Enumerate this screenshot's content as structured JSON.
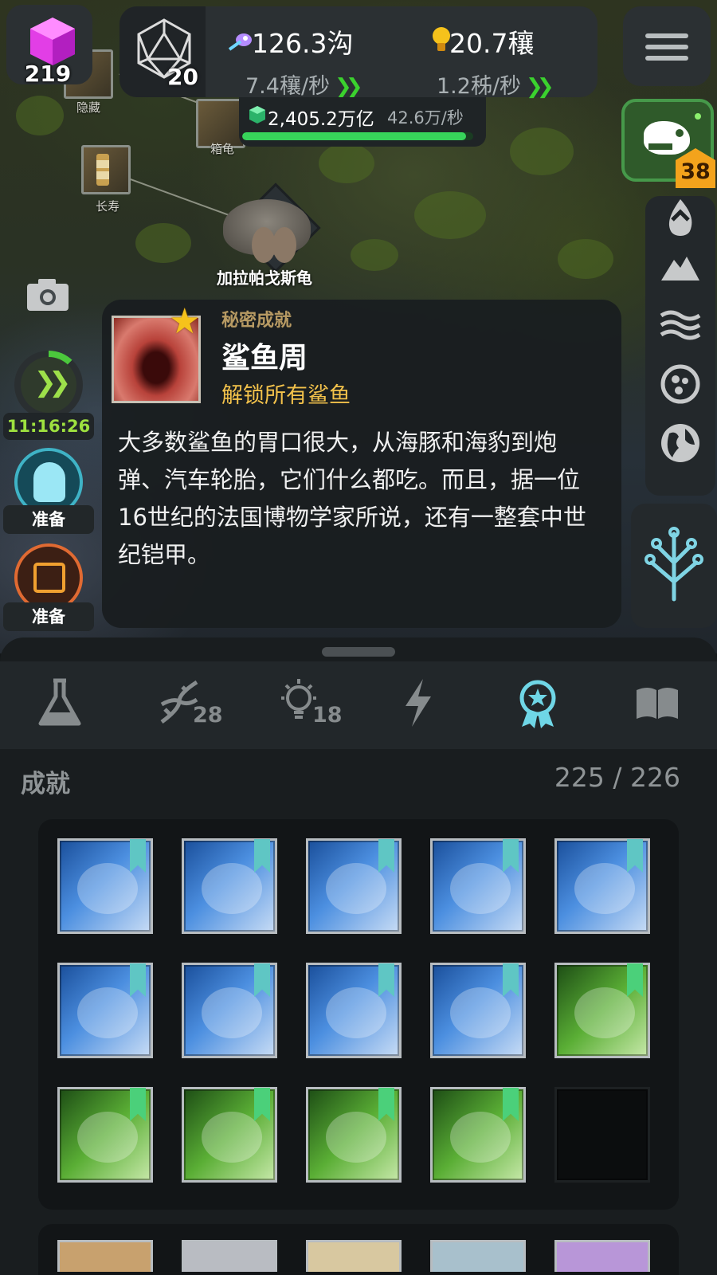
{
  "hud": {
    "cube_count": "219",
    "d20_level": "20",
    "dna": {
      "amount": "126.3沟",
      "rate": "7.4穰/秒"
    },
    "ideas": {
      "amount": "20.7穰",
      "rate": "1.2秭/秒"
    },
    "gems": {
      "amount": "2,405.2万亿",
      "rate": "42.6万/秒",
      "progress": 0.97
    },
    "dino_level": "38"
  },
  "map": {
    "nodes": [
      {
        "label": "隐藏",
        "icon": "hidden-node-icon"
      },
      {
        "label": "箱龟",
        "icon": "box-turtle-node-icon"
      },
      {
        "label": "长寿",
        "icon": "hourglass-icon"
      }
    ],
    "marker_label": "加拉帕戈斯龟"
  },
  "left_column": {
    "speed_timer": "11:16:26",
    "ghost_label": "准备",
    "calendar_label": "准备"
  },
  "popup": {
    "category": "秘密成就",
    "title": "鲨鱼周",
    "subtitle": "解锁所有鲨鱼",
    "description": "大多数鲨鱼的胃口很大，从海豚和海豹到炮弹、汽车轮胎，它们什么都吃。而且，据一位16世纪的法国博物学家所说，还有一整套中世纪铠甲。"
  },
  "tabs": [
    {
      "icon": "flask-icon",
      "badge": ""
    },
    {
      "icon": "dna-icon",
      "badge": "28"
    },
    {
      "icon": "lightbulb-icon",
      "badge": "18"
    },
    {
      "icon": "lightning-icon",
      "badge": ""
    },
    {
      "icon": "achievement-medal-icon",
      "badge": "",
      "active": true
    },
    {
      "icon": "book-icon",
      "badge": ""
    }
  ],
  "achievements": {
    "title": "成就",
    "count": "225 / 226",
    "items": [
      {
        "motif": "dna-helix",
        "tier": "blue"
      },
      {
        "motif": "jellyfish",
        "tier": "blue"
      },
      {
        "motif": "marine-reptile",
        "tier": "blue"
      },
      {
        "motif": "rock",
        "tier": "blue"
      },
      {
        "motif": "early-humans",
        "tier": "blue"
      },
      {
        "motif": "human-face",
        "tier": "blue"
      },
      {
        "motif": "human-head",
        "tier": "blue"
      },
      {
        "motif": "orb",
        "tier": "blue"
      },
      {
        "motif": "lions",
        "tier": "blue"
      },
      {
        "motif": "dinosaur-skull",
        "tier": "green"
      },
      {
        "motif": "meteor",
        "tier": "green"
      },
      {
        "motif": "t-rex",
        "tier": "green"
      },
      {
        "motif": "crocodile",
        "tier": "green"
      },
      {
        "motif": "bird",
        "tier": "green"
      },
      {
        "motif": "locked",
        "tier": "locked"
      }
    ]
  },
  "colors": {
    "accent_green": "#3bd12e",
    "gold": "#f3c24b",
    "active_tab": "#6fd6e6"
  }
}
